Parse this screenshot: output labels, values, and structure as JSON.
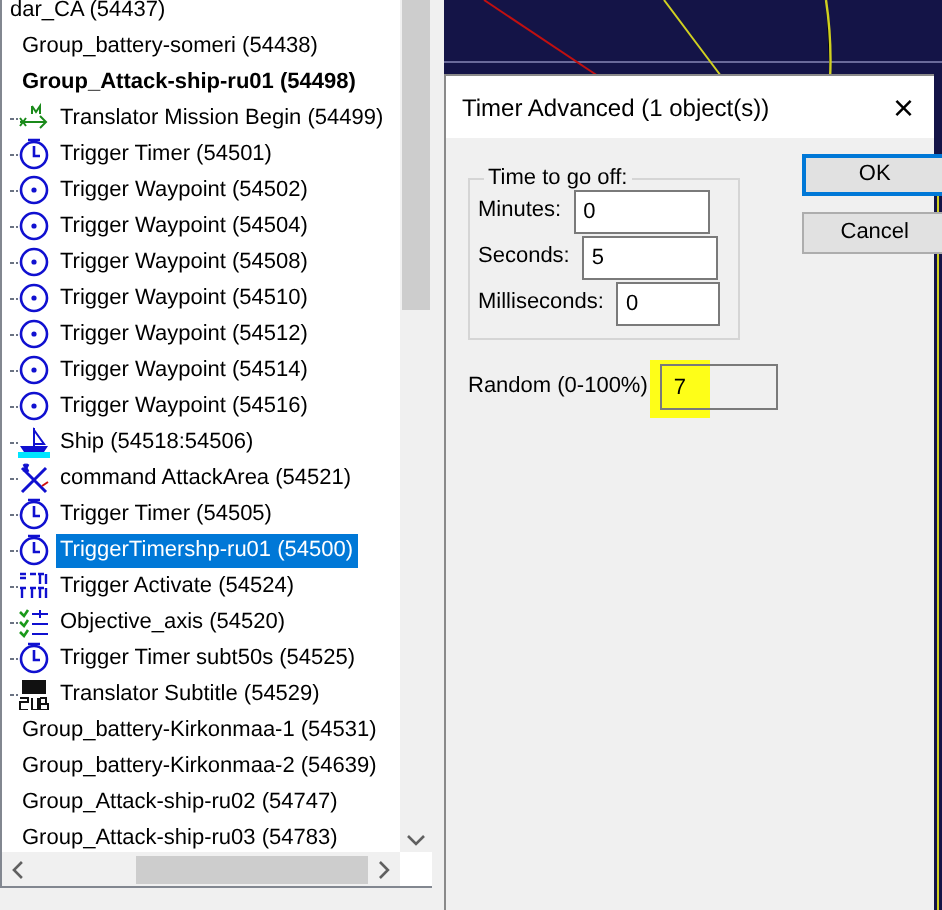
{
  "tree": {
    "items": [
      {
        "label": "dar_CA (54437)",
        "kind": "plain",
        "bold": false,
        "selected": false
      },
      {
        "label": "Group_battery-someri (54438)",
        "kind": "group",
        "bold": false,
        "selected": false
      },
      {
        "label": "Group_Attack-ship-ru01 (54498)",
        "kind": "group",
        "bold": true,
        "selected": false
      },
      {
        "label": "Translator Mission Begin (54499)",
        "kind": "translator",
        "bold": false,
        "selected": false
      },
      {
        "label": "Trigger Timer (54501)",
        "kind": "timer",
        "bold": false,
        "selected": false
      },
      {
        "label": "Trigger Waypoint (54502)",
        "kind": "waypoint",
        "bold": false,
        "selected": false
      },
      {
        "label": "Trigger Waypoint (54504)",
        "kind": "waypoint",
        "bold": false,
        "selected": false
      },
      {
        "label": "Trigger Waypoint (54508)",
        "kind": "waypoint",
        "bold": false,
        "selected": false
      },
      {
        "label": "Trigger Waypoint (54510)",
        "kind": "waypoint",
        "bold": false,
        "selected": false
      },
      {
        "label": "Trigger Waypoint (54512)",
        "kind": "waypoint",
        "bold": false,
        "selected": false
      },
      {
        "label": "Trigger Waypoint (54514)",
        "kind": "waypoint",
        "bold": false,
        "selected": false
      },
      {
        "label": "Trigger Waypoint (54516)",
        "kind": "waypoint",
        "bold": false,
        "selected": false
      },
      {
        "label": "Ship (54518:54506)",
        "kind": "ship",
        "bold": false,
        "selected": false
      },
      {
        "label": "command AttackArea (54521)",
        "kind": "command",
        "bold": false,
        "selected": false
      },
      {
        "label": "Trigger Timer (54505)",
        "kind": "timer",
        "bold": false,
        "selected": false
      },
      {
        "label": "TriggerTimershp-ru01 (54500)",
        "kind": "timer",
        "bold": false,
        "selected": true
      },
      {
        "label": "Trigger Activate (54524)",
        "kind": "activate",
        "bold": false,
        "selected": false
      },
      {
        "label": "Objective_axis (54520)",
        "kind": "objective",
        "bold": false,
        "selected": false
      },
      {
        "label": "Trigger Timer subt50s (54525)",
        "kind": "timer",
        "bold": false,
        "selected": false
      },
      {
        "label": "Translator Subtitle (54529)",
        "kind": "subtitle",
        "bold": false,
        "selected": false
      },
      {
        "label": "Group_battery-Kirkonmaa-1 (54531)",
        "kind": "group",
        "bold": false,
        "selected": false
      },
      {
        "label": "Group_battery-Kirkonmaa-2 (54639)",
        "kind": "group",
        "bold": false,
        "selected": false
      },
      {
        "label": "Group_Attack-ship-ru02 (54747)",
        "kind": "group",
        "bold": false,
        "selected": false
      },
      {
        "label": "Group_Attack-ship-ru03 (54783)",
        "kind": "group",
        "bold": false,
        "selected": false
      }
    ]
  },
  "dialog": {
    "title": "Timer Advanced (1 object(s))",
    "close": "×",
    "group_title": "Time to go off:",
    "fields": [
      {
        "label": "Minutes:",
        "value": "0"
      },
      {
        "label": "Seconds:",
        "value": "5"
      },
      {
        "label": "Milliseconds:",
        "value": "0"
      }
    ],
    "random": {
      "label": "Random (0-100%)",
      "value": "7",
      "highlighted": true
    },
    "buttons": [
      {
        "label": "OK",
        "focused": true
      },
      {
        "label": "Cancel",
        "focused": false
      }
    ]
  }
}
